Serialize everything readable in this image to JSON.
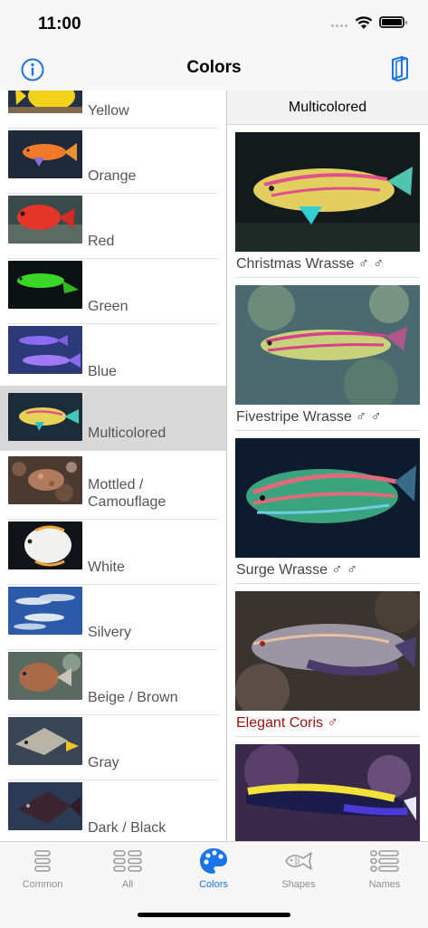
{
  "status": {
    "time": "11:00"
  },
  "nav": {
    "title": "Colors"
  },
  "colors": [
    {
      "label": "Yellow"
    },
    {
      "label": "Orange"
    },
    {
      "label": "Red"
    },
    {
      "label": "Green"
    },
    {
      "label": "Blue"
    },
    {
      "label": "Multicolored"
    },
    {
      "label": "Mottled / Camouflage"
    },
    {
      "label": "White"
    },
    {
      "label": "Silvery"
    },
    {
      "label": "Beige / Brown"
    },
    {
      "label": "Gray"
    },
    {
      "label": "Dark / Black"
    }
  ],
  "selected_color": "Multicolored",
  "right_pane": {
    "header": "Multicolored",
    "fish": [
      {
        "name": "Christmas Wrasse ♂ ♂"
      },
      {
        "name": "Fivestripe Wrasse ♂ ♂"
      },
      {
        "name": "Surge Wrasse ♂ ♂"
      },
      {
        "name": "Elegant Coris ♂"
      },
      {
        "name": ""
      }
    ]
  },
  "tabs": [
    {
      "label": "Common",
      "icon": "common-list-icon"
    },
    {
      "label": "All",
      "icon": "all-grid-icon"
    },
    {
      "label": "Colors",
      "icon": "palette-icon"
    },
    {
      "label": "Shapes",
      "icon": "fish-shape-icon"
    },
    {
      "label": "Names",
      "icon": "names-list-icon"
    }
  ],
  "active_tab": "Colors",
  "theme": {
    "accent": "#1a73e8",
    "inactive": "#8e8e8e",
    "red_text": "#9c1010"
  }
}
